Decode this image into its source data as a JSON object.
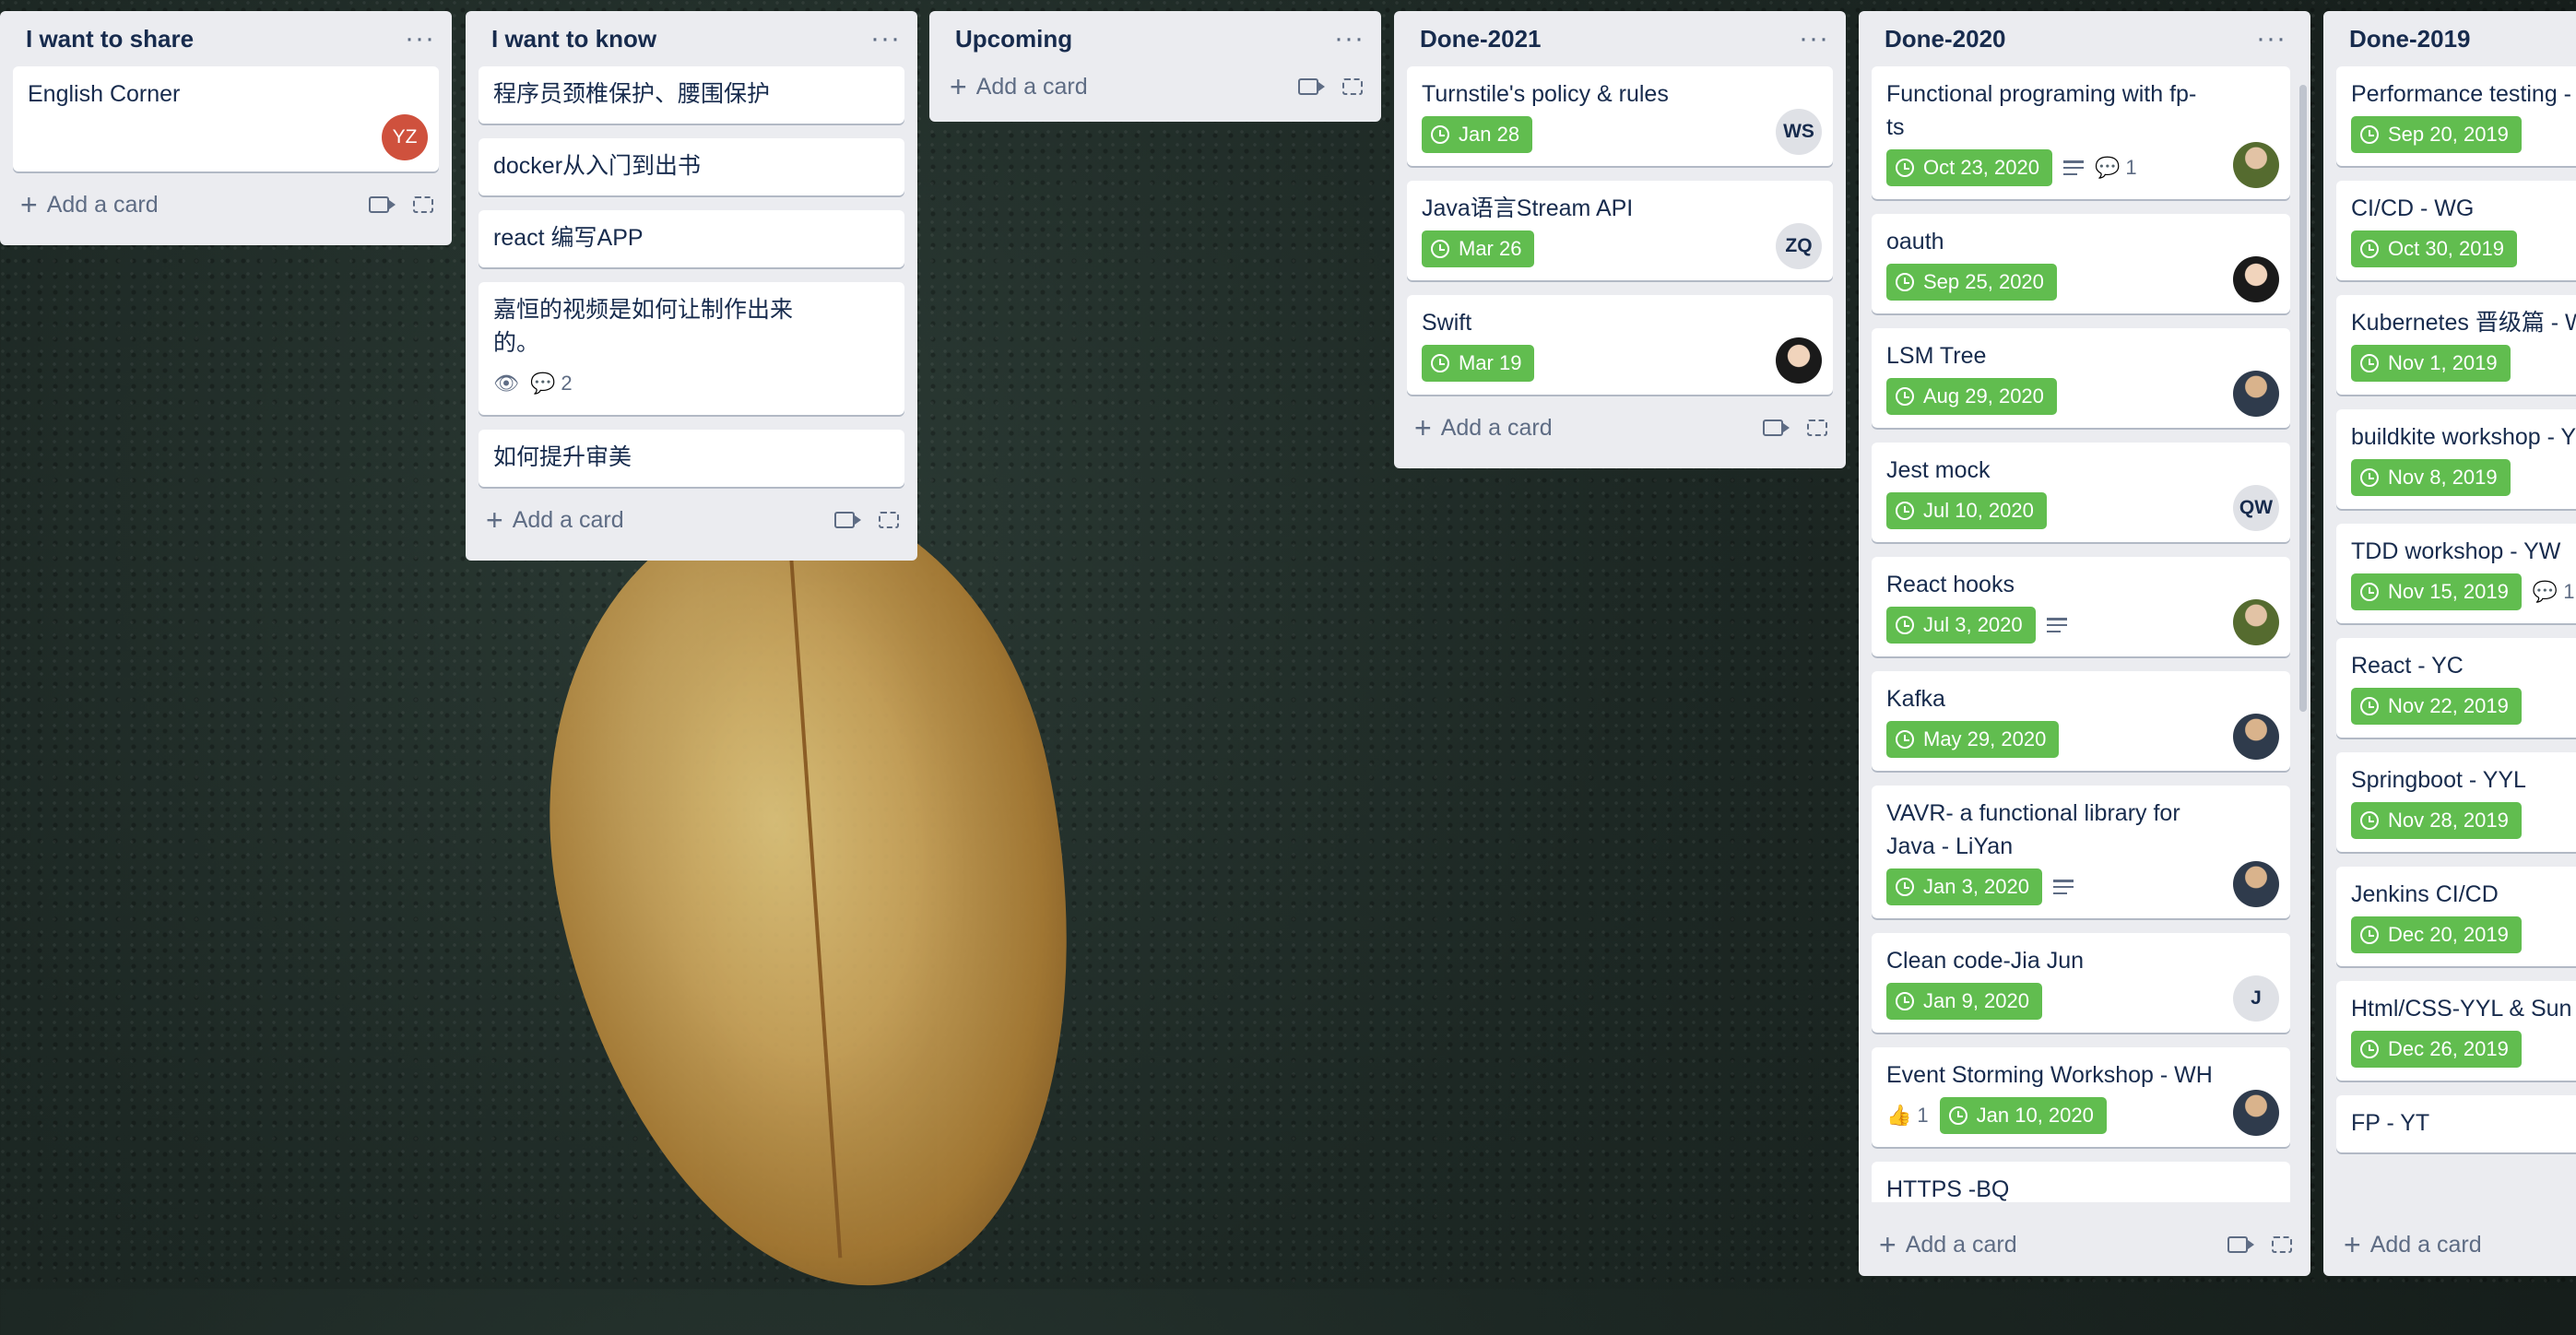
{
  "lists": [
    {
      "title": "I want to share",
      "cards": [
        {
          "title": "English Corner",
          "due": "",
          "avatar": "YZ"
        }
      ],
      "add_label": "Add a card"
    },
    {
      "title": "I want to know",
      "cards": [
        {
          "title": "程序员颈椎保护、腰围保护"
        },
        {
          "title": "docker从入门到出书"
        },
        {
          "title": "react 编写APP"
        },
        {
          "title": "嘉恒的视频是如何让制作出来的。",
          "comments": "2"
        },
        {
          "title": "如何提升审美"
        }
      ],
      "add_label": "Add a card"
    },
    {
      "title": "Upcoming",
      "cards": [],
      "add_label": "Add a card"
    },
    {
      "title": "Done-2021",
      "cards": [
        {
          "title": "Turnstile's policy & rules",
          "due": "Jan 28",
          "avatar": "WS"
        },
        {
          "title": "Java语言Stream API",
          "due": "Mar 26",
          "avatar": "ZQ"
        },
        {
          "title": "Swift",
          "due": "Mar 19"
        }
      ],
      "add_label": "Add a card"
    },
    {
      "title": "Done-2020",
      "cards": [
        {
          "title": "Functional programing with fp-ts",
          "due": "Oct 23, 2020",
          "comments": "1"
        },
        {
          "title": "oauth",
          "due": "Sep 25, 2020"
        },
        {
          "title": "LSM Tree",
          "due": "Aug 29, 2020"
        },
        {
          "title": "Jest mock",
          "due": "Jul 10, 2020",
          "avatar": "QW"
        },
        {
          "title": "React hooks",
          "due": "Jul 3, 2020"
        },
        {
          "title": "Kafka",
          "due": "May 29, 2020"
        },
        {
          "title": "VAVR- a functional library for Java - LiYan",
          "due": "Jan 3, 2020"
        },
        {
          "title": "Clean code-Jia Jun",
          "due": "Jan 9, 2020",
          "avatar": "J"
        },
        {
          "title": "Event Storming Workshop - WH",
          "due": "Jan 10, 2020",
          "likes": "1"
        },
        {
          "title": "HTTPS -BQ"
        }
      ],
      "add_label": "Add a card"
    },
    {
      "title": "Done-2019",
      "cards": [
        {
          "title": "Performance testing -",
          "due": "Sep 20, 2019"
        },
        {
          "title": "CI/CD - WG",
          "due": "Oct 30, 2019"
        },
        {
          "title": "Kubernetes 晋级篇 - W",
          "due": "Nov 1, 2019"
        },
        {
          "title": "buildkite workshop - Y",
          "due": "Nov 8, 2019"
        },
        {
          "title": "TDD workshop - YW",
          "due": "Nov 15, 2019",
          "comments": "1"
        },
        {
          "title": "React - YC",
          "due": "Nov 22, 2019"
        },
        {
          "title": "Springboot - YYL",
          "due": "Nov 28, 2019"
        },
        {
          "title": "Jenkins CI/CD",
          "due": "Dec 20, 2019"
        },
        {
          "title": "Html/CSS-YYL & Sun",
          "due": "Dec 26, 2019"
        },
        {
          "title": "FP - YT"
        }
      ],
      "add_label": "Add a card"
    }
  ],
  "colors": {
    "due_green": "#61bd4f",
    "list_bg": "#ebecf0",
    "avatar_red": "#cf513d"
  }
}
